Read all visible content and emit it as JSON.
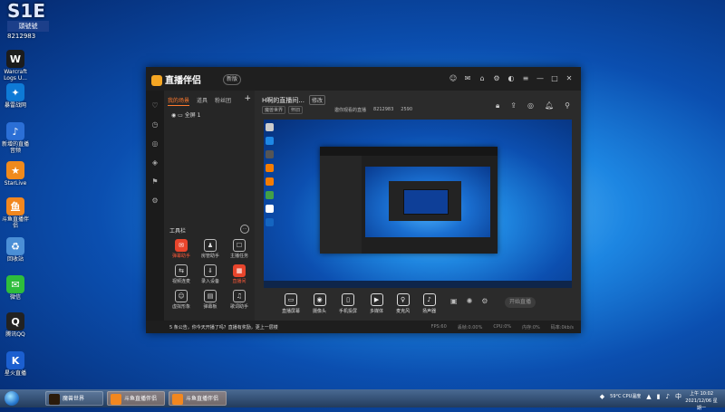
{
  "profile": {
    "logo": "S1E",
    "tag": "頭號號",
    "number": "8212983"
  },
  "desktop_icons": [
    {
      "label": "Warcraft Logs U...",
      "icon": "warcraft-icon",
      "color": "#1c1c1c",
      "glyph": "W"
    },
    {
      "label": "暴雷战网",
      "icon": "battlenet-icon",
      "color": "#0e7ad6",
      "glyph": "✦"
    },
    {
      "label": "新增的直播音频",
      "icon": "audio-icon",
      "color": "#2b6fd6",
      "glyph": "♪"
    },
    {
      "label": "StarLive",
      "icon": "starlive-icon",
      "color": "#f08a1c",
      "glyph": "★"
    },
    {
      "label": "斗鱼直播伴侣",
      "icon": "douyu-icon",
      "color": "#f2871f",
      "glyph": "鱼"
    },
    {
      "label": "回收站",
      "icon": "recycle-bin-icon",
      "color": "#4b8fd6",
      "glyph": "♻"
    },
    {
      "label": "微信",
      "icon": "wechat-icon",
      "color": "#2ebd3c",
      "glyph": "✉"
    },
    {
      "label": "腾讯QQ",
      "icon": "qq-icon",
      "color": "#222222",
      "glyph": "Q"
    },
    {
      "label": "星火直播",
      "icon": "k-icon",
      "color": "#1b5fd0",
      "glyph": "K"
    }
  ],
  "window": {
    "brand": "直播伴侣",
    "version": "新版",
    "title_icons": [
      "avatar-icon",
      "message-icon",
      "gift-icon",
      "settings-icon",
      "skin-icon",
      "menu-icon",
      "minimize-icon",
      "maximize-icon",
      "close-icon"
    ],
    "tabs": [
      "我的场景",
      "道具",
      "粉丝团"
    ],
    "scene": "全屏 1",
    "tools_title": "工具栏",
    "tools": [
      {
        "label": "弹幕助手",
        "icon": "danmaku-icon",
        "glyph": "✉",
        "highlight": true
      },
      {
        "label": "房管助手",
        "icon": "admin-icon",
        "glyph": "♟",
        "highlight": false
      },
      {
        "label": "主播任务",
        "icon": "task-icon",
        "glyph": "☐",
        "highlight": false
      },
      {
        "label": "视频连麦",
        "icon": "video-link-icon",
        "glyph": "⇆",
        "highlight": false
      },
      {
        "label": "录入设备",
        "icon": "download-icon",
        "glyph": "⇓",
        "highlight": false
      },
      {
        "label": "直播间",
        "icon": "room-icon",
        "glyph": "▦",
        "highlight": true
      },
      {
        "label": "虚拟形象",
        "icon": "avatar-face-icon",
        "glyph": "☺",
        "highlight": false
      },
      {
        "label": "弹幕板",
        "icon": "board-icon",
        "glyph": "▤",
        "highlight": false
      },
      {
        "label": "歌词助手",
        "icon": "lyrics-icon",
        "glyph": "♫",
        "highlight": false
      }
    ],
    "room_title": "H啊的直播间...",
    "edit_label": "修改",
    "chips": [
      "魔兽世界",
      "怀旧"
    ],
    "meta": [
      "邀你观看的直播",
      "8212983",
      "2590"
    ],
    "controls": [
      {
        "label": "直播屏幕",
        "icon": "screen-icon",
        "glyph": "▭"
      },
      {
        "label": "摄像头",
        "icon": "camera-icon",
        "glyph": "◉"
      },
      {
        "label": "手机投屏",
        "icon": "phone-icon",
        "glyph": "▯"
      },
      {
        "label": "多媒体",
        "icon": "media-icon",
        "glyph": "▶"
      },
      {
        "label": "麦克风",
        "icon": "mic-icon",
        "glyph": "♀"
      },
      {
        "label": "扬声器",
        "icon": "speaker-icon",
        "glyph": "♪"
      }
    ],
    "start_live": "开始直播",
    "status_message": "5 条公告，你今天开播了吗？直播有奖励，更上一层楼",
    "status_stats": [
      "FPS:60",
      "丢帧:0.00%",
      "CPU:0%",
      "内存:0%",
      "码率:0kb/s"
    ]
  },
  "taskbar": {
    "buttons": [
      {
        "label": "魔兽世界",
        "icon": "wow-icon",
        "color": "#2b1b0b",
        "active": false
      },
      {
        "label": "斗鱼直播伴侣",
        "icon": "douyu-task-icon",
        "color": "#f2871f",
        "active": true
      },
      {
        "label": "斗鱼直播伴侣",
        "icon": "douyu-task-icon-2",
        "color": "#f2871f",
        "active": true
      }
    ],
    "weather": "59°C CPU温度",
    "time": "上午 10:02",
    "date": "2021/12/06 星期一"
  }
}
